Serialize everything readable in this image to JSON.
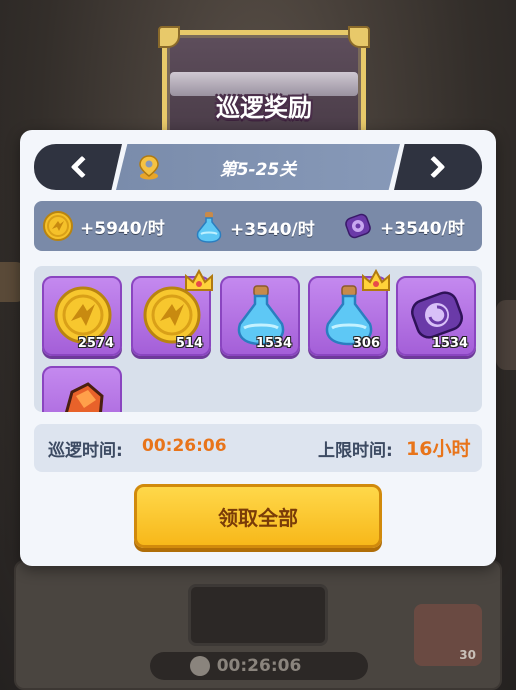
{
  "title": "巡逻奖励",
  "stage": {
    "label": "第5-25关"
  },
  "rates": [
    {
      "icon": "gold-coin-icon",
      "value": "+5940/时"
    },
    {
      "icon": "blue-potion-icon",
      "value": "+3540/时"
    },
    {
      "icon": "purple-scroll-icon",
      "value": "+3540/时"
    }
  ],
  "rewards": [
    {
      "icon": "gold-coin-icon",
      "count": "2574",
      "crown": false
    },
    {
      "icon": "gold-coin-icon",
      "count": "514",
      "crown": true
    },
    {
      "icon": "blue-potion-icon",
      "count": "1534",
      "crown": false
    },
    {
      "icon": "blue-potion-icon",
      "count": "306",
      "crown": true
    },
    {
      "icon": "purple-scroll-icon",
      "count": "1534",
      "crown": false
    },
    {
      "icon": "orange-ore-icon",
      "count": "",
      "crown": false
    }
  ],
  "patrol_time": {
    "label": "巡逻时间:",
    "value": "00:26:06"
  },
  "limit_time": {
    "label": "上限时间:",
    "value": "16小时"
  },
  "claim_label": "领取全部",
  "background": {
    "timer": "00:26:06",
    "hourglass_count": "30"
  },
  "colors": {
    "accent": "#e8741a",
    "button": "#f7b81a",
    "item_bg": "#b06fe2"
  }
}
